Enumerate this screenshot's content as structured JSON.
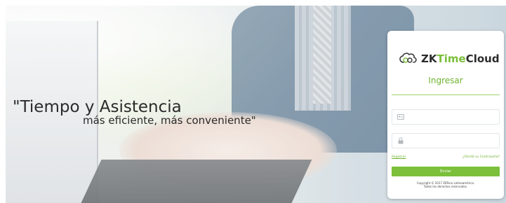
{
  "hero": {
    "slogan_line1": "\"Tiempo y Asistencia",
    "slogan_line2": "más eficiente, más conveniente\""
  },
  "login": {
    "brand_prefix": "ZK",
    "brand_accent": "Time",
    "brand_suffix": "Cloud",
    "title": "Ingresar",
    "username_placeholder": "",
    "password_placeholder": "",
    "register_link": "Registrar",
    "forgot_link": "¿Olvidó su Contraseña?",
    "submit_label": "Enviar",
    "footer_line1": "Copyright © 2017 ZKTeco Latinoamérica.",
    "footer_line2": "Todos los derechos reservados."
  },
  "icons": {
    "brand": "cloud-link-icon",
    "username": "user-card-icon",
    "password": "lock-icon"
  },
  "colors": {
    "accent": "#7bbf3a",
    "title_green": "#6fb32f",
    "text_dark": "#2b2b2b"
  }
}
